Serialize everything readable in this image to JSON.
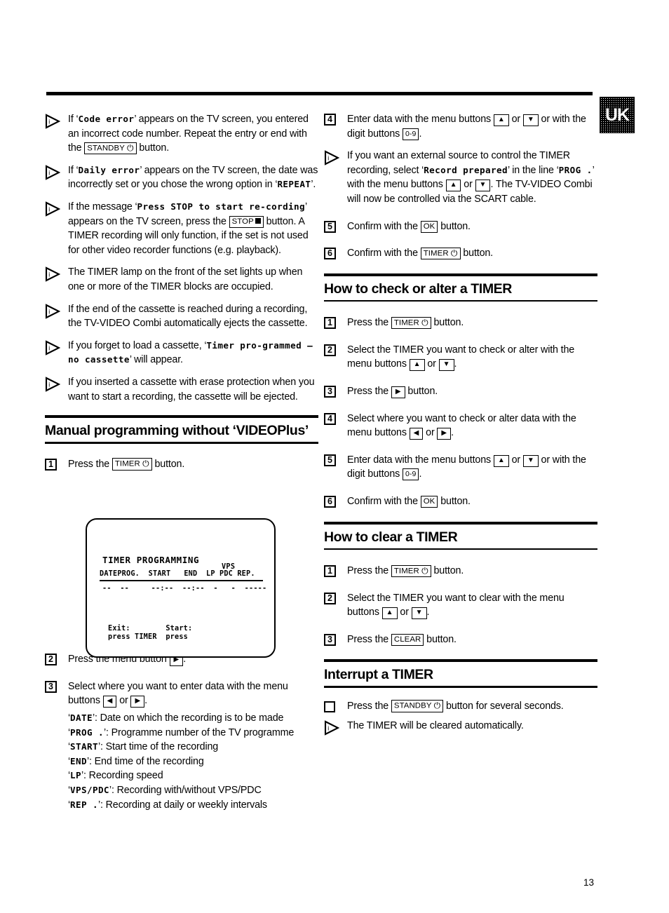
{
  "page": {
    "number": "13",
    "locale_badge": "UK"
  },
  "icons": {
    "note_triangle": "triangle-note-icon",
    "square_bullet": "square-bullet-icon",
    "power": "⏻",
    "clock": "⏻",
    "up": "▲",
    "down": "▼",
    "left": "◀",
    "right": "▶"
  },
  "keys": {
    "standby": "STANDBY",
    "stop": "STOP",
    "timer": "TIMER",
    "ok": "OK",
    "clear": "CLEAR",
    "digits": "0-9"
  },
  "left_column": {
    "notes": [
      {
        "parts": [
          {
            "t": "If ‘",
            "s": "normal"
          },
          {
            "t": "Code error",
            "s": "mono"
          },
          {
            "t": "’ appears on the TV screen, you entered an incorrect code number. Repeat the entry or end with the ",
            "s": "normal"
          },
          {
            "t": "STANDBY",
            "s": "key-standby"
          },
          {
            "t": " button.",
            "s": "normal"
          }
        ]
      },
      {
        "parts": [
          {
            "t": "If ‘",
            "s": "normal"
          },
          {
            "t": "Daily error",
            "s": "mono"
          },
          {
            "t": "’ appears on the TV screen, the date was incorrectly set or you chose the wrong option in ‘",
            "s": "normal"
          },
          {
            "t": "REPEAT",
            "s": "mono"
          },
          {
            "t": "’.",
            "s": "normal"
          }
        ]
      },
      {
        "parts": [
          {
            "t": "If the message ‘",
            "s": "normal"
          },
          {
            "t": "Press STOP to start re-cording",
            "s": "mono"
          },
          {
            "t": "’ appears on the TV screen, press the ",
            "s": "normal"
          },
          {
            "t": "STOP",
            "s": "key-stop"
          },
          {
            "t": " button. A TIMER recording will only function, if the set is not used for other video recorder functions (e.g. playback).",
            "s": "normal"
          }
        ]
      },
      {
        "parts": [
          {
            "t": "The TIMER lamp on the front of the set lights up when one or more of the TIMER blocks are occupied.",
            "s": "normal"
          }
        ]
      },
      {
        "parts": [
          {
            "t": "If the end of the cassette is reached during a recording, the TV-VIDEO Combi automatically ejects the cassette.",
            "s": "normal"
          }
        ]
      },
      {
        "parts": [
          {
            "t": "If you forget to load a cassette, ‘",
            "s": "normal"
          },
          {
            "t": "Timer pro-grammed – no cassette",
            "s": "mono"
          },
          {
            "t": "’ will appear.",
            "s": "normal"
          }
        ]
      },
      {
        "parts": [
          {
            "t": "If you inserted a cassette with erase protection when you want to start a recording, the cassette will be ejected.",
            "s": "normal"
          }
        ]
      }
    ],
    "manual_section": {
      "heading": "Manual programming without ‘VIDEOPlus’",
      "steps": [
        {
          "num": "1",
          "parts": [
            {
              "t": "Press the ",
              "s": "normal"
            },
            {
              "t": "TIMER",
              "s": "key-timer"
            },
            {
              "t": " button.",
              "s": "normal"
            }
          ]
        },
        {
          "num": "2",
          "parts": [
            {
              "t": "Press the menu button ",
              "s": "normal"
            },
            {
              "t": "▶",
              "s": "key-arrow"
            },
            {
              "t": ".",
              "s": "normal"
            }
          ]
        },
        {
          "num": "3",
          "parts": [
            {
              "t": "Select where you want to enter data with the menu buttons ",
              "s": "normal"
            },
            {
              "t": "◀",
              "s": "key-arrow"
            },
            {
              "t": " or ",
              "s": "normal"
            },
            {
              "t": "▶",
              "s": "key-arrow"
            },
            {
              "t": ".",
              "s": "normal"
            }
          ]
        }
      ],
      "field_definitions": [
        {
          "key": "DATE",
          "desc": ": Date on which the recording is to be made"
        },
        {
          "key": "PROG .",
          "desc": ": Programme number of the TV programme"
        },
        {
          "key": "START",
          "desc": ": Start time of the recording"
        },
        {
          "key": "END",
          "desc": ": End time of the recording"
        },
        {
          "key": "LP",
          "desc": ": Recording speed"
        },
        {
          "key": "VPS/PDC",
          "desc": ": Recording with/without VPS/PDC"
        },
        {
          "key": "REP .",
          "desc": ": Recording at daily or weekly intervals"
        }
      ]
    }
  },
  "tv_screen": {
    "title": "TIMER PROGRAMMING",
    "vps_label": "VPS",
    "headers": "DATEPROG.  START   END  LP PDC REP.",
    "data_row": "--  --     --:--  --:--  -   -  -----",
    "footer_line1": "Exit:        Start:",
    "footer_line2": "press TIMER  press"
  },
  "right_column": {
    "continued_steps": [
      {
        "num": "4",
        "parts": [
          {
            "t": "Enter data with the menu buttons ",
            "s": "normal"
          },
          {
            "t": "▲",
            "s": "key-arrow"
          },
          {
            "t": " or ",
            "s": "normal"
          },
          {
            "t": "▼",
            "s": "key-arrow"
          },
          {
            "t": " or with the digit buttons ",
            "s": "normal"
          },
          {
            "t": "0-9",
            "s": "key-digits"
          },
          {
            "t": ".",
            "s": "normal"
          }
        ]
      }
    ],
    "note": {
      "parts": [
        {
          "t": "If you want an external source to control the TIMER recording, select ‘",
          "s": "normal"
        },
        {
          "t": "Record prepared",
          "s": "mono"
        },
        {
          "t": "’ in the line ‘",
          "s": "normal"
        },
        {
          "t": "PROG .",
          "s": "mono"
        },
        {
          "t": "’ with the menu buttons ",
          "s": "normal"
        },
        {
          "t": "▲",
          "s": "key-arrow"
        },
        {
          "t": " or ",
          "s": "normal"
        },
        {
          "t": "▼",
          "s": "key-arrow"
        },
        {
          "t": ". The TV-VIDEO Combi will now be controlled via the SCART cable.",
          "s": "normal"
        }
      ]
    },
    "confirm_steps": [
      {
        "num": "5",
        "parts": [
          {
            "t": "Confirm with the ",
            "s": "normal"
          },
          {
            "t": "OK",
            "s": "key-plain"
          },
          {
            "t": " button.",
            "s": "normal"
          }
        ]
      },
      {
        "num": "6",
        "parts": [
          {
            "t": "Confirm with the ",
            "s": "normal"
          },
          {
            "t": "TIMER",
            "s": "key-timer"
          },
          {
            "t": " button.",
            "s": "normal"
          }
        ]
      }
    ],
    "check_section": {
      "heading": "How to check or alter a TIMER",
      "steps": [
        {
          "num": "1",
          "parts": [
            {
              "t": "Press the ",
              "s": "normal"
            },
            {
              "t": "TIMER",
              "s": "key-timer"
            },
            {
              "t": " button.",
              "s": "normal"
            }
          ]
        },
        {
          "num": "2",
          "parts": [
            {
              "t": "Select the TIMER you want to check or alter with the menu buttons ",
              "s": "normal"
            },
            {
              "t": "▲",
              "s": "key-arrow"
            },
            {
              "t": " or ",
              "s": "normal"
            },
            {
              "t": "▼",
              "s": "key-arrow"
            },
            {
              "t": ".",
              "s": "normal"
            }
          ]
        },
        {
          "num": "3",
          "parts": [
            {
              "t": "Press the ",
              "s": "normal"
            },
            {
              "t": "▶",
              "s": "key-arrow"
            },
            {
              "t": " button.",
              "s": "normal"
            }
          ]
        },
        {
          "num": "4",
          "parts": [
            {
              "t": "Select where you want to check or alter data with the menu buttons ",
              "s": "normal"
            },
            {
              "t": "◀",
              "s": "key-arrow"
            },
            {
              "t": " or ",
              "s": "normal"
            },
            {
              "t": "▶",
              "s": "key-arrow"
            },
            {
              "t": ".",
              "s": "normal"
            }
          ]
        },
        {
          "num": "5",
          "parts": [
            {
              "t": "Enter data with the menu buttons ",
              "s": "normal"
            },
            {
              "t": "▲",
              "s": "key-arrow"
            },
            {
              "t": " or ",
              "s": "normal"
            },
            {
              "t": "▼",
              "s": "key-arrow"
            },
            {
              "t": " or with the digit buttons ",
              "s": "normal"
            },
            {
              "t": "0-9",
              "s": "key-digits"
            },
            {
              "t": ".",
              "s": "normal"
            }
          ]
        },
        {
          "num": "6",
          "parts": [
            {
              "t": "Confirm with the ",
              "s": "normal"
            },
            {
              "t": "OK",
              "s": "key-plain"
            },
            {
              "t": " button.",
              "s": "normal"
            }
          ]
        }
      ]
    },
    "clear_section": {
      "heading": "How to clear a TIMER",
      "steps": [
        {
          "num": "1",
          "parts": [
            {
              "t": "Press the ",
              "s": "normal"
            },
            {
              "t": "TIMER",
              "s": "key-timer"
            },
            {
              "t": " button.",
              "s": "normal"
            }
          ]
        },
        {
          "num": "2",
          "parts": [
            {
              "t": "Select the TIMER you want to clear with the menu buttons ",
              "s": "normal"
            },
            {
              "t": "▲",
              "s": "key-arrow"
            },
            {
              "t": " or ",
              "s": "normal"
            },
            {
              "t": "▼",
              "s": "key-arrow"
            },
            {
              "t": ".",
              "s": "normal"
            }
          ]
        },
        {
          "num": "3",
          "parts": [
            {
              "t": "Press the ",
              "s": "normal"
            },
            {
              "t": "CLEAR",
              "s": "key-plain"
            },
            {
              "t": " button.",
              "s": "normal"
            }
          ]
        }
      ]
    },
    "interrupt_section": {
      "heading": "Interrupt a TIMER",
      "action": {
        "parts": [
          {
            "t": "Press the ",
            "s": "normal"
          },
          {
            "t": "STANDBY",
            "s": "key-standby"
          },
          {
            "t": " button for several seconds.",
            "s": "normal"
          }
        ]
      },
      "result": {
        "parts": [
          {
            "t": "The TIMER will be cleared automatically.",
            "s": "normal"
          }
        ]
      }
    }
  }
}
